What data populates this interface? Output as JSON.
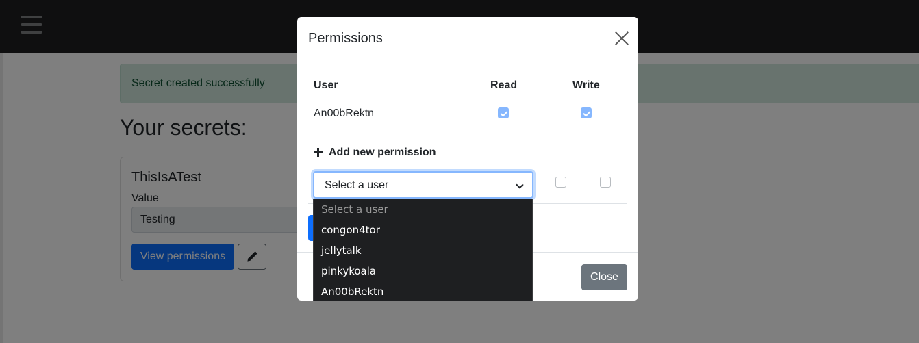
{
  "alert": {
    "text": "Secret created successfully"
  },
  "page": {
    "heading": "Your secrets:",
    "card": {
      "title": "ThisIsATest",
      "value_label": "Value",
      "value": "Testing",
      "view_button": "View permissions"
    }
  },
  "modal": {
    "title": "Permissions",
    "columns": {
      "user": "User",
      "read": "Read",
      "write": "Write"
    },
    "rows": [
      {
        "user": "An00bRektn",
        "read": true,
        "write": true
      }
    ],
    "add_label": "Add new permission",
    "select_value": "Select a user",
    "close_button": "Close"
  },
  "dropdown": {
    "options": [
      "Select a user",
      "congon4tor",
      "jellytalk",
      "pinkykoala",
      "An00bRektn"
    ]
  },
  "colors": {
    "primary": "#0d6efd",
    "secondary": "#6c757d",
    "alert_bg": "#d1e7dd",
    "topbar": "#1e1f21"
  },
  "icons": [
    "hamburger-icon",
    "close-icon",
    "plus-icon",
    "pencil-icon",
    "chevron-down-icon"
  ]
}
